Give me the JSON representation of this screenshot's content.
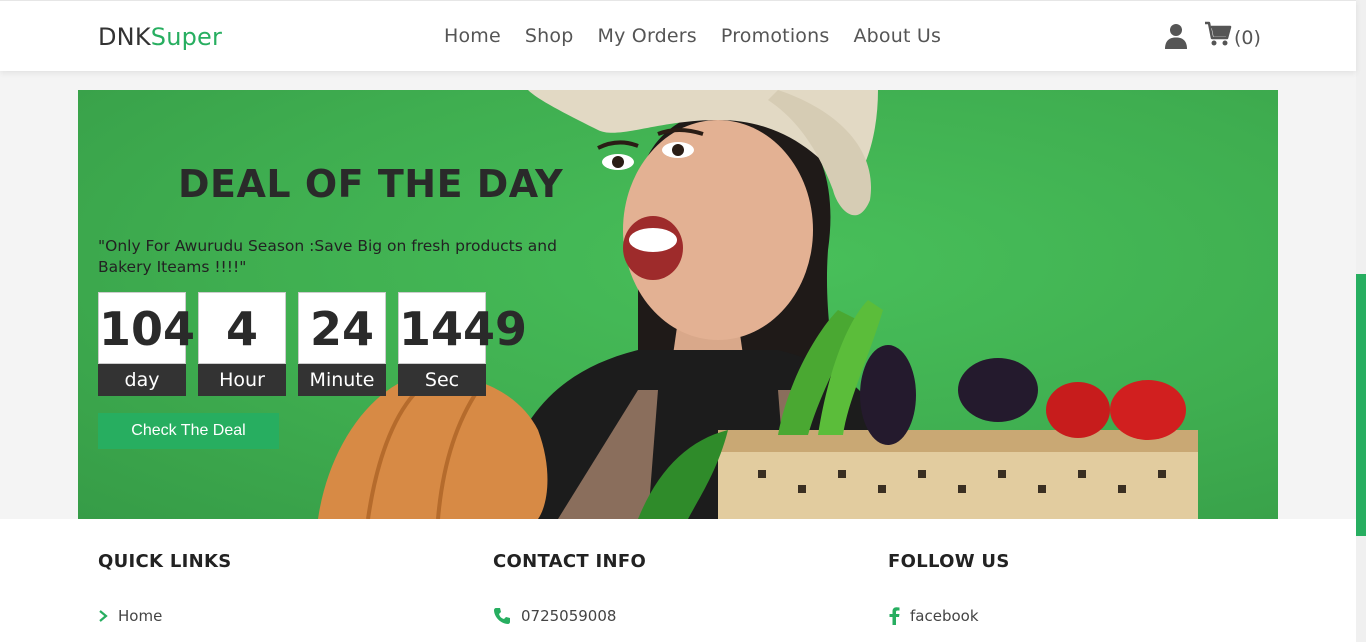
{
  "brand": {
    "part1": "DNK",
    "part2": "Super"
  },
  "nav": [
    "Home",
    "Shop",
    "My Orders",
    "Promotions",
    "About Us"
  ],
  "cart": {
    "count_label": "(0)"
  },
  "banner": {
    "title": "DEAL OF THE DAY",
    "subtitle": "\"Only For Awurudu Season :Save Big on fresh products and Bakery Iteams !!!!\"",
    "countdown": [
      {
        "value": "104",
        "label": "day"
      },
      {
        "value": "4",
        "label": "Hour"
      },
      {
        "value": "24",
        "label": "Minute"
      },
      {
        "value": "1449",
        "label": "Sec"
      }
    ],
    "button_label": "Check The Deal"
  },
  "footer": {
    "quick_links": {
      "heading": "QUICK LINKS",
      "items": [
        "Home"
      ]
    },
    "contact_info": {
      "heading": "CONTACT INFO",
      "phone": "0725059008"
    },
    "follow_us": {
      "heading": "FOLLOW US",
      "items": [
        "facebook"
      ]
    }
  },
  "colors": {
    "brand_green": "#27ae60",
    "banner_green": "#3fae50",
    "dark": "#333333"
  },
  "icons": [
    "user-icon",
    "cart-icon",
    "chevron-right-icon",
    "phone-icon",
    "facebook-icon"
  ]
}
